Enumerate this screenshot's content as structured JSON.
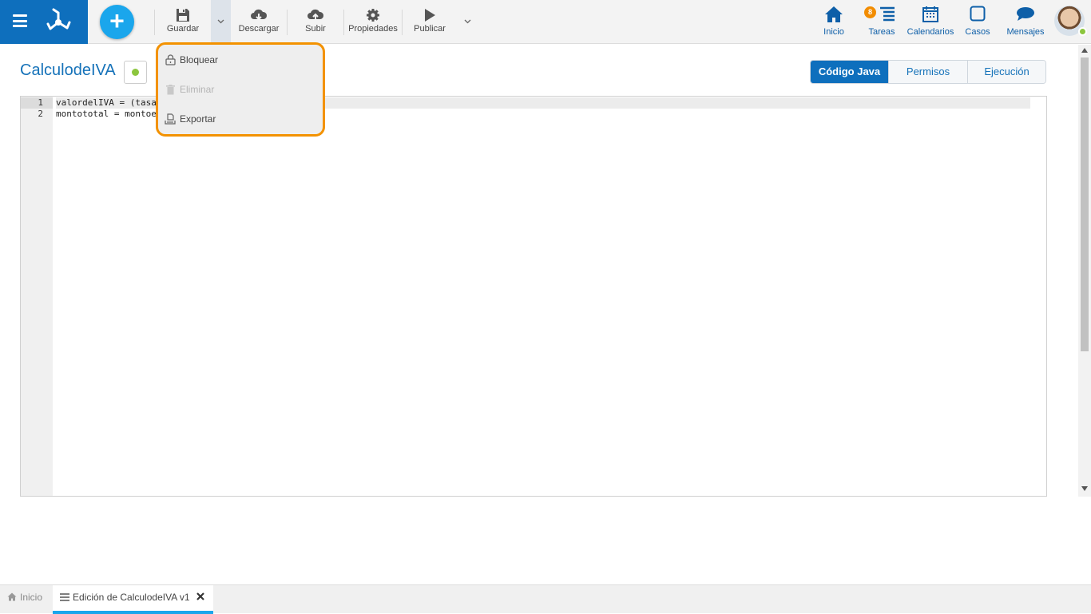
{
  "toolbar": {
    "guardar": "Guardar",
    "descargar": "Descargar",
    "subir": "Subir",
    "propiedades": "Propiedades",
    "publicar": "Publicar"
  },
  "nav": {
    "inicio": "Inicio",
    "tareas": "Tareas",
    "tareas_badge": "8",
    "calendarios": "Calendarios",
    "casos": "Casos",
    "mensajes": "Mensajes"
  },
  "dropdown": {
    "bloquear": "Bloquear",
    "eliminar": "Eliminar",
    "exportar": "Exportar"
  },
  "page": {
    "title": "CalculodeIVA"
  },
  "tabs": {
    "codigo": "Código Java",
    "permisos": "Permisos",
    "ejecucion": "Ejecución"
  },
  "editor": {
    "line1_no": "1",
    "line2_no": "2",
    "line1": "valordelIVA = (tasa",
    "line2": "montototal = montoe"
  },
  "bottom": {
    "tab_inicio": "Inicio",
    "tab_edicion": "Edición de CalculodeIVA v1"
  },
  "colors": {
    "brand": "#0e6fbd",
    "accent": "#1aa6ec",
    "highlight": "#f39200",
    "status": "#8cc63e"
  },
  "icons": [
    "menu-icon",
    "logo-icon",
    "plus-icon",
    "save-icon",
    "chevron-down-icon",
    "cloud-download-icon",
    "cloud-upload-icon",
    "gear-icon",
    "play-icon",
    "home-icon",
    "tasks-icon",
    "calendar-icon",
    "cases-icon",
    "chat-icon",
    "lock-icon",
    "trash-icon",
    "export-icon",
    "close-icon"
  ]
}
